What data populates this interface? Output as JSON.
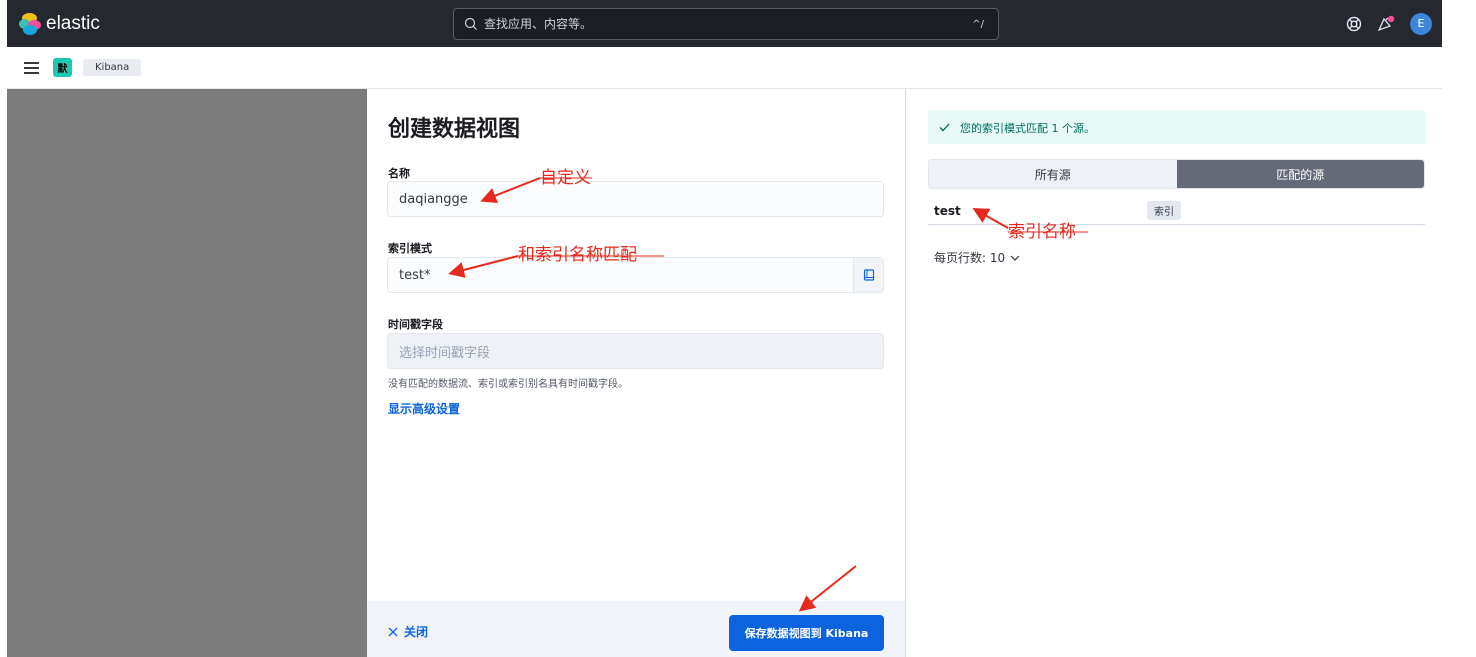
{
  "header": {
    "brand": "elastic",
    "search_placeholder": "查找应用、内容等。",
    "shortcut": "^/",
    "avatar_initial": "E"
  },
  "subbar": {
    "space_badge": "默",
    "breadcrumb": "Kibana"
  },
  "form": {
    "title": "创建数据视图",
    "name_label": "名称",
    "name_value": "daqiangge",
    "index_label": "索引模式",
    "index_value": "test*",
    "timestamp_label": "时间戳字段",
    "timestamp_placeholder": "选择时间戳字段",
    "timestamp_help": "没有匹配的数据流、索引或索引别名具有时间戳字段。",
    "advanced_link": "显示高级设置",
    "close_label": "关闭",
    "save_label": "保存数据视图到 Kibana"
  },
  "results": {
    "callout": "您的索引模式匹配 1 个源。",
    "tabs": [
      {
        "label": "所有源",
        "active": false
      },
      {
        "label": "匹配的源",
        "active": true
      }
    ],
    "rows": [
      {
        "name": "test",
        "type": "索引"
      }
    ],
    "rows_per_page": "每页行数: 10"
  },
  "annotations": {
    "name_note": "自定义",
    "index_note": "和索引名称匹配",
    "result_note": "索引名称"
  },
  "colors": {
    "header_bg": "#25282f",
    "primary": "#0b64dd",
    "success_bg": "#e6f9f7",
    "annotation": "#e8291d"
  }
}
